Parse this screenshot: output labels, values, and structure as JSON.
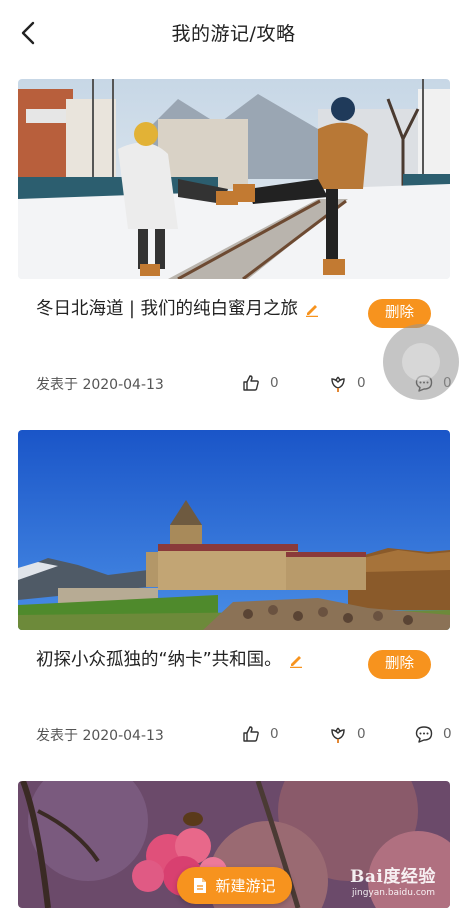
{
  "header": {
    "title": "我的游记/攻略",
    "back_icon": "chevron-left-icon"
  },
  "posts": [
    {
      "title": "冬日北海道 | 我们的纯白蜜月之旅",
      "delete_label": "删除",
      "date": "发表于 2020-04-13",
      "likes": "0",
      "favorites": "0",
      "comments": "0"
    },
    {
      "title": "初探小众孤独的“纳卡”共和国。",
      "delete_label": "删除",
      "date": "发表于 2020-04-13",
      "likes": "0",
      "favorites": "0",
      "comments": "0"
    }
  ],
  "fab": {
    "label": "新建游记",
    "icon": "document-icon"
  },
  "watermark": {
    "main": "Bai度经验",
    "sub": "jingyan.baidu.com"
  },
  "colors": {
    "accent": "#f7931e",
    "text": "#222222",
    "muted": "#666666"
  }
}
